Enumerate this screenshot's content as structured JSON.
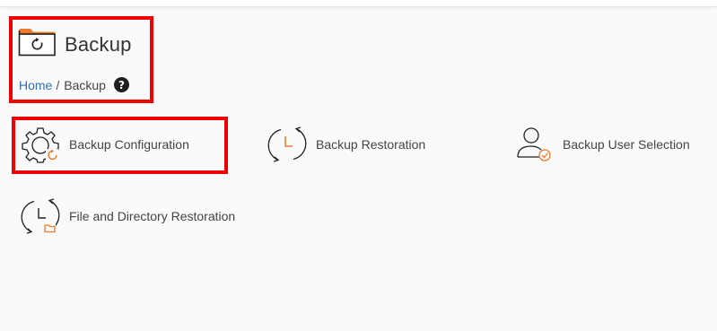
{
  "header": {
    "title": "Backup",
    "icon": "folder-restore-icon"
  },
  "breadcrumb": {
    "home": "Home",
    "separator": "/",
    "current": "Backup",
    "help_symbol": "?"
  },
  "tools": [
    {
      "label": "Backup Configuration",
      "icon": "gear-backup-icon"
    },
    {
      "label": "Backup Restoration",
      "icon": "clock-restore-icon"
    },
    {
      "label": "Backup User Selection",
      "icon": "user-check-icon"
    },
    {
      "label": "File and Directory Restoration",
      "icon": "clock-folder-icon"
    }
  ],
  "colors": {
    "accent_orange": "#f07a2a",
    "highlight_red": "#ee0000",
    "link_blue": "#2f6fb3"
  }
}
